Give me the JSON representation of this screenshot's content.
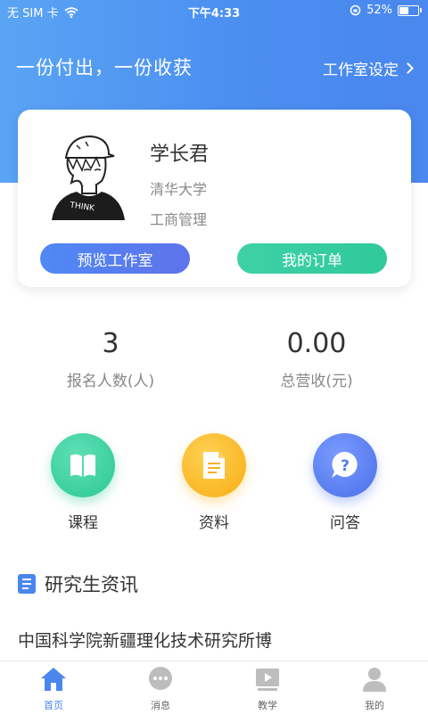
{
  "status_bar": {
    "carrier": "无 SIM 卡",
    "time": "下午4:33",
    "battery_text": "52%",
    "battery_level": 0.52
  },
  "header": {
    "slogan": "一份付出，一份收获",
    "settings_label": "工作室设定"
  },
  "profile": {
    "name": "学长君",
    "school": "清华大学",
    "major": "工商管理",
    "preview_button": "预览工作室",
    "orders_button": "我的订单"
  },
  "stats": [
    {
      "value": "3",
      "label": "报名人数(人)"
    },
    {
      "value": "0.00",
      "label": "总营收(元)"
    }
  ],
  "features": [
    {
      "label": "课程",
      "icon": "book-icon",
      "color": "#2fcf9c"
    },
    {
      "label": "资料",
      "icon": "document-icon",
      "color": "#f9b81c"
    },
    {
      "label": "问答",
      "icon": "question-icon",
      "color": "#4f78ee"
    }
  ],
  "news": {
    "title": "研究生资讯",
    "items": [
      "中国科学院新疆理化技术研究所博"
    ]
  },
  "tabs": [
    {
      "label": "首页",
      "icon": "home-icon",
      "active": true
    },
    {
      "label": "消息",
      "icon": "message-icon",
      "active": false
    },
    {
      "label": "教学",
      "icon": "teaching-icon",
      "active": false
    },
    {
      "label": "我的",
      "icon": "user-icon",
      "active": false
    }
  ],
  "colors": {
    "primary": "#4a86ee",
    "green": "#2fc99a",
    "yellow": "#f9b81c"
  }
}
